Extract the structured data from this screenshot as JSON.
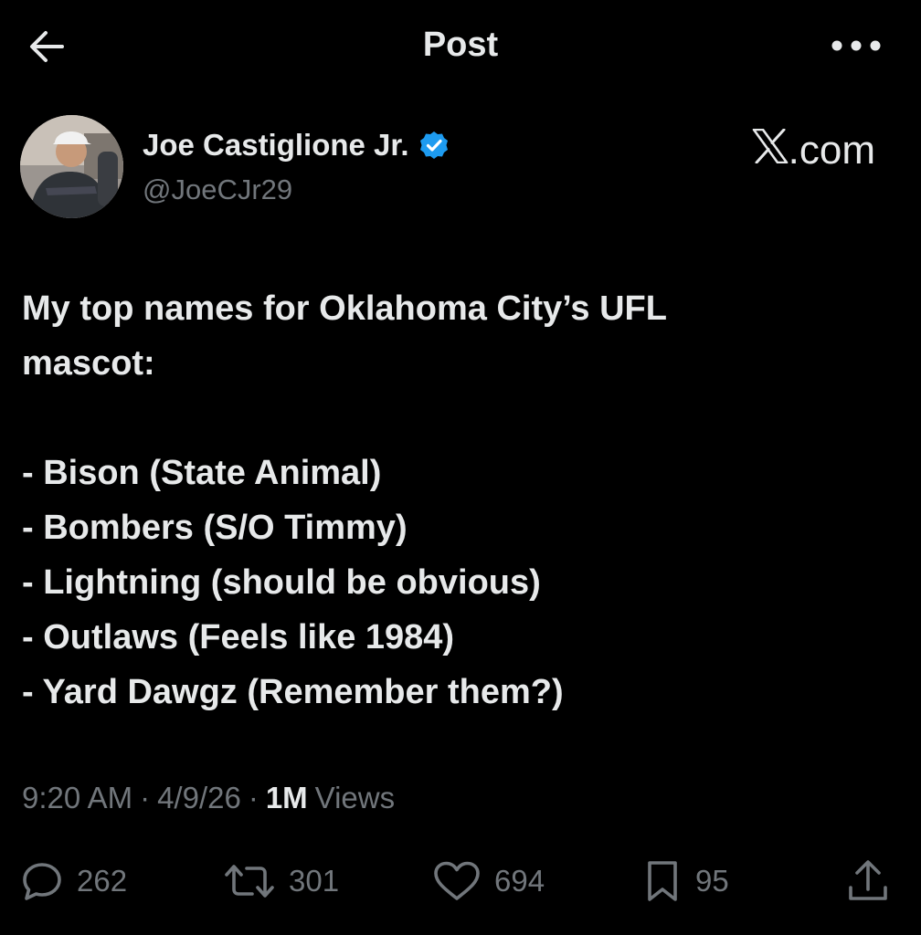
{
  "topbar": {
    "title": "Post",
    "back_icon": "arrow-left-icon",
    "more_icon": "more-horizontal-icon"
  },
  "author": {
    "display_name": "Joe Castiglione Jr.",
    "handle": "@JoeCJr29",
    "verified": true,
    "verified_color": "#1d9bf0"
  },
  "brand": {
    "text": ".com"
  },
  "post": {
    "lines": [
      "My top names for Oklahoma City’s UFL",
      "mascot:"
    ],
    "list": [
      "- Bison (State Animal)",
      "- Bombers (S/O Timmy)",
      "- Lightning (should be obvious)",
      "- Outlaws (Feels like 1984)",
      "- Yard Dawgz (Remember them?)"
    ]
  },
  "meta": {
    "time": "9:20 AM",
    "separator": "·",
    "date": "4/9/26",
    "views_count": "1M",
    "views_label": "Views"
  },
  "actions": {
    "replies": "262",
    "reposts": "301",
    "likes": "694",
    "bookmarks": "95"
  },
  "colors": {
    "background": "#000000",
    "text": "#e7e9ea",
    "muted": "#71767b",
    "accent": "#1d9bf0"
  }
}
